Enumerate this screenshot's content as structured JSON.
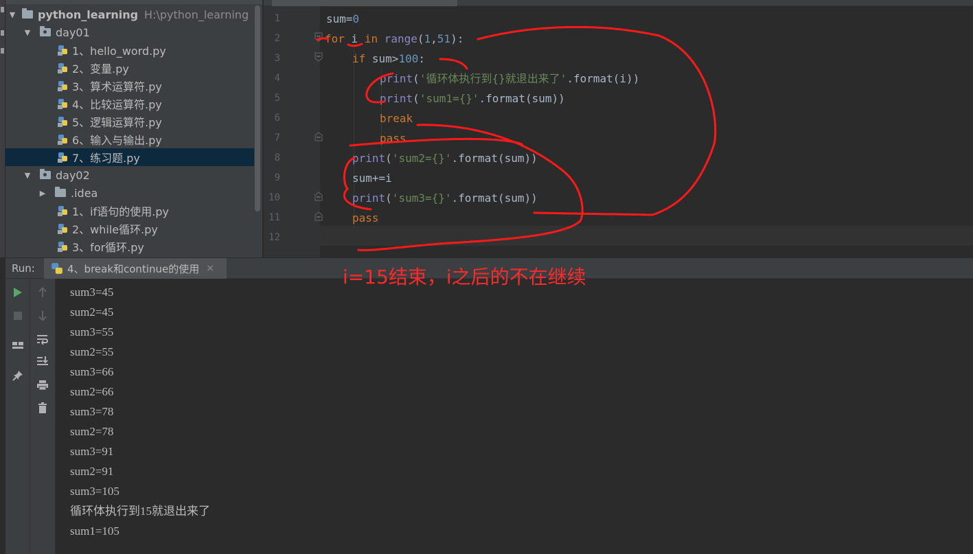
{
  "project_tree": {
    "root": {
      "name": "python_learning",
      "path": "H:\\python_learning"
    },
    "rows": [
      {
        "label": "day01",
        "kind": "package",
        "expanded": true
      },
      {
        "label": "1、hello_word.py",
        "kind": "python-file"
      },
      {
        "label": "2、变量.py",
        "kind": "python-file"
      },
      {
        "label": "3、算术运算符.py",
        "kind": "python-file"
      },
      {
        "label": "4、比较运算符.py",
        "kind": "python-file"
      },
      {
        "label": "5、逻辑运算符.py",
        "kind": "python-file"
      },
      {
        "label": "6、输入与输出.py",
        "kind": "python-file"
      },
      {
        "label": "7、练习题.py",
        "kind": "python-file",
        "selected": true
      },
      {
        "label": "day02",
        "kind": "package",
        "expanded": true
      },
      {
        "label": ".idea",
        "kind": "folder",
        "expanded": false
      },
      {
        "label": "1、if语句的使用.py",
        "kind": "python-file"
      },
      {
        "label": "2、while循环.py",
        "kind": "python-file"
      },
      {
        "label": "3、for循环.py",
        "kind": "python-file"
      }
    ]
  },
  "editor": {
    "line_numbers": [
      "1",
      "2",
      "3",
      "4",
      "5",
      "6",
      "7",
      "8",
      "9",
      "10",
      "11",
      "12"
    ],
    "code": {
      "l1_a": "sum",
      "l1_b": "=",
      "l1_c": "0",
      "l2_kw_for": "for",
      "l2_var": " i ",
      "l2_kw_in": "in",
      "l2_fn": " range",
      "l2_open": "(",
      "l2_n1": "1",
      "l2_comma": ",",
      "l2_n2": "51",
      "l2_close": "):",
      "l3_kw_if": "if",
      "l3_cond": " sum>",
      "l3_num": "100",
      "l3_colon": ":",
      "l4_fn": "print",
      "l4_open": "(",
      "l4_str": "'循环体执行到{}就退出来了'",
      "l4_rest": ".format(i))",
      "l5_fn": "print",
      "l5_open": "(",
      "l5_str": "'sum1={}'",
      "l5_rest": ".format(sum))",
      "l6_kw": "break",
      "l7_kw": "pass",
      "l8_fn": "print",
      "l8_open": "(",
      "l8_str": "'sum2={}'",
      "l8_rest": ".format(sum))",
      "l9_a": "sum",
      "l9_b": "+=",
      "l9_c": "i",
      "l10_fn": "print",
      "l10_open": "(",
      "l10_str": "'sum3={}'",
      "l10_rest": ".format(sum))",
      "l11_kw": "pass"
    }
  },
  "run_window": {
    "label": "Run:",
    "tab_title": "4、break和continue的使用",
    "tab_close": "×",
    "console_lines": [
      "sum3=45",
      "sum2=45",
      "sum3=55",
      "sum2=55",
      "sum3=66",
      "sum2=66",
      "sum3=78",
      "sum2=78",
      "sum3=91",
      "sum2=91",
      "sum3=105",
      "循环体执行到15就退出来了",
      "sum1=105"
    ]
  },
  "annotation": {
    "text": "i=15结束，i之后的不在继续",
    "color": "#ff2a2a"
  },
  "colors": {
    "keyword": "#cc7832",
    "builtin": "#8888c6",
    "string": "#6a8759",
    "number": "#6897bb",
    "selection": "#0d293e"
  }
}
